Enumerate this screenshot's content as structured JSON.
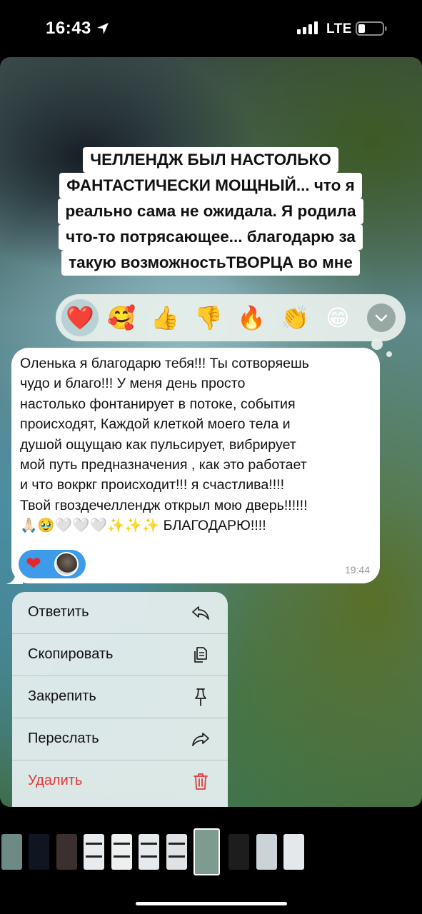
{
  "status_bar": {
    "time": "16:43",
    "carrier": "LTE"
  },
  "story": {
    "headline_lines": [
      "ЧЕЛЛЕНДЖ БЫЛ НАСТОЛЬКО",
      "ФАНТАСТИЧЕСКИ МОЩНЫЙ... что я",
      "реально сама не ожидала. Я родила",
      "что-то потрясающее... благодарю за",
      "такую возможностьТВОРЦА во мне"
    ]
  },
  "reactions": {
    "items": [
      {
        "icon": "heart-icon",
        "glyph": "❤️",
        "selected": true
      },
      {
        "icon": "smiling-face-with-hearts-icon",
        "glyph": "🥰",
        "selected": false
      },
      {
        "icon": "thumbs-up-icon",
        "glyph": "👍",
        "selected": false
      },
      {
        "icon": "thumbs-down-icon",
        "glyph": "👎",
        "selected": false
      },
      {
        "icon": "fire-icon",
        "glyph": "🔥",
        "selected": false
      },
      {
        "icon": "clapping-hands-icon",
        "glyph": "👏",
        "selected": false
      },
      {
        "icon": "grinning-face-icon",
        "glyph": "😁",
        "selected": false
      }
    ]
  },
  "message": {
    "text": "Оленька я благодарю тебя!!! Ты сотворяешь\nчудо и благо!!! У меня день просто\nнастолько фонтанирует в потоке, события\nпроисходят, Каждой клеткой моего тела и\nдушой ощущаю как пульсирует, вибрирует\nмой путь предназначения , как это работает\nи что вокркг происходит!!! я счастлива!!!!\nТвой гвоздечеллендж открыл мою дверь!!!!!!\n🙏🏻🥹🤍🤍🤍✨✨✨ БЛАГОДАРЮ!!!!",
    "reaction_glyph": "❤",
    "time": "19:44"
  },
  "menu": {
    "items": [
      {
        "label": "Ответить",
        "icon": "reply-icon",
        "danger": false
      },
      {
        "label": "Скопировать",
        "icon": "copy-icon",
        "danger": false
      },
      {
        "label": "Закрепить",
        "icon": "pin-icon",
        "danger": false
      },
      {
        "label": "Переслать",
        "icon": "forward-icon",
        "danger": false
      },
      {
        "label": "Удалить",
        "icon": "trash-icon",
        "danger": true
      }
    ]
  },
  "thumbnails": {
    "count": 11,
    "active_index": 7,
    "colors": [
      "#6d8a84",
      "#0f1622",
      "#3a3030",
      "#e9ecef",
      "#eef0f0",
      "#e6eaec",
      "#dfe3e6",
      "#7d9b8e",
      "#1d1d1d",
      "#c9d3d8",
      "#e5e8ea"
    ]
  }
}
